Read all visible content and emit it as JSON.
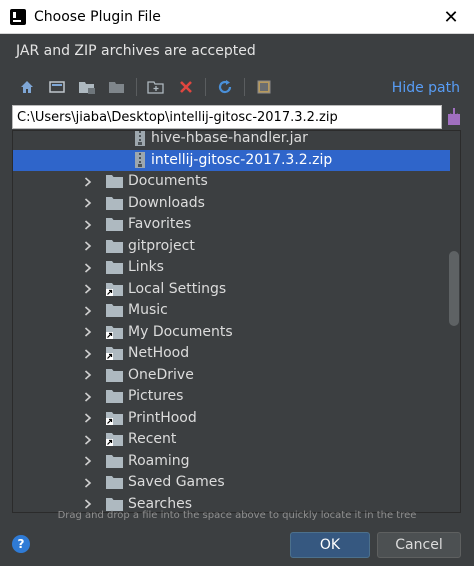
{
  "window": {
    "title": "Choose Plugin File",
    "close_glyph": "✕"
  },
  "description": "JAR and ZIP archives are accepted",
  "toolbar": {
    "buttons": [
      {
        "name": "home-icon"
      },
      {
        "name": "desktop-icon"
      },
      {
        "name": "project-folder-icon"
      },
      {
        "name": "module-folder-icon"
      },
      {
        "name": "new-folder-icon"
      },
      {
        "name": "delete-icon"
      },
      {
        "name": "refresh-icon"
      },
      {
        "name": "show-hidden-icon"
      }
    ],
    "hide_path_label": "Hide path"
  },
  "path": {
    "value": "C:\\Users\\jiaba\\Desktop\\intellij-gitosc-2017.3.2.zip"
  },
  "tree": {
    "rows": [
      {
        "label": "hive-hbase-handler.jar",
        "kind": "jar",
        "level": 2,
        "expandable": false,
        "selected": false,
        "shortcut": false
      },
      {
        "label": "intellij-gitosc-2017.3.2.zip",
        "kind": "zip",
        "level": 2,
        "expandable": false,
        "selected": true,
        "shortcut": false
      },
      {
        "label": "Documents",
        "kind": "folder",
        "level": 1,
        "expandable": true,
        "selected": false,
        "shortcut": false
      },
      {
        "label": "Downloads",
        "kind": "folder",
        "level": 1,
        "expandable": true,
        "selected": false,
        "shortcut": false
      },
      {
        "label": "Favorites",
        "kind": "folder",
        "level": 1,
        "expandable": true,
        "selected": false,
        "shortcut": false
      },
      {
        "label": "gitproject",
        "kind": "folder",
        "level": 1,
        "expandable": true,
        "selected": false,
        "shortcut": false
      },
      {
        "label": "Links",
        "kind": "folder",
        "level": 1,
        "expandable": true,
        "selected": false,
        "shortcut": false
      },
      {
        "label": "Local Settings",
        "kind": "folder",
        "level": 1,
        "expandable": true,
        "selected": false,
        "shortcut": true
      },
      {
        "label": "Music",
        "kind": "folder",
        "level": 1,
        "expandable": true,
        "selected": false,
        "shortcut": false
      },
      {
        "label": "My Documents",
        "kind": "folder",
        "level": 1,
        "expandable": true,
        "selected": false,
        "shortcut": true
      },
      {
        "label": "NetHood",
        "kind": "folder",
        "level": 1,
        "expandable": true,
        "selected": false,
        "shortcut": true
      },
      {
        "label": "OneDrive",
        "kind": "folder",
        "level": 1,
        "expandable": true,
        "selected": false,
        "shortcut": false
      },
      {
        "label": "Pictures",
        "kind": "folder",
        "level": 1,
        "expandable": true,
        "selected": false,
        "shortcut": false
      },
      {
        "label": "PrintHood",
        "kind": "folder",
        "level": 1,
        "expandable": true,
        "selected": false,
        "shortcut": true
      },
      {
        "label": "Recent",
        "kind": "folder",
        "level": 1,
        "expandable": true,
        "selected": false,
        "shortcut": true
      },
      {
        "label": "Roaming",
        "kind": "folder",
        "level": 1,
        "expandable": true,
        "selected": false,
        "shortcut": false
      },
      {
        "label": "Saved Games",
        "kind": "folder",
        "level": 1,
        "expandable": true,
        "selected": false,
        "shortcut": false
      },
      {
        "label": "Searches",
        "kind": "folder",
        "level": 1,
        "expandable": true,
        "selected": false,
        "shortcut": false
      }
    ]
  },
  "footer": {
    "drag_hint": "Drag and drop a file into the space above to quickly locate it in the tree",
    "help_glyph": "?",
    "ok_label": "OK",
    "cancel_label": "Cancel"
  },
  "colors": {
    "selection": "#2f65ca",
    "link": "#589df6",
    "folder": "#aeb9c0",
    "background": "#3c3f41"
  }
}
